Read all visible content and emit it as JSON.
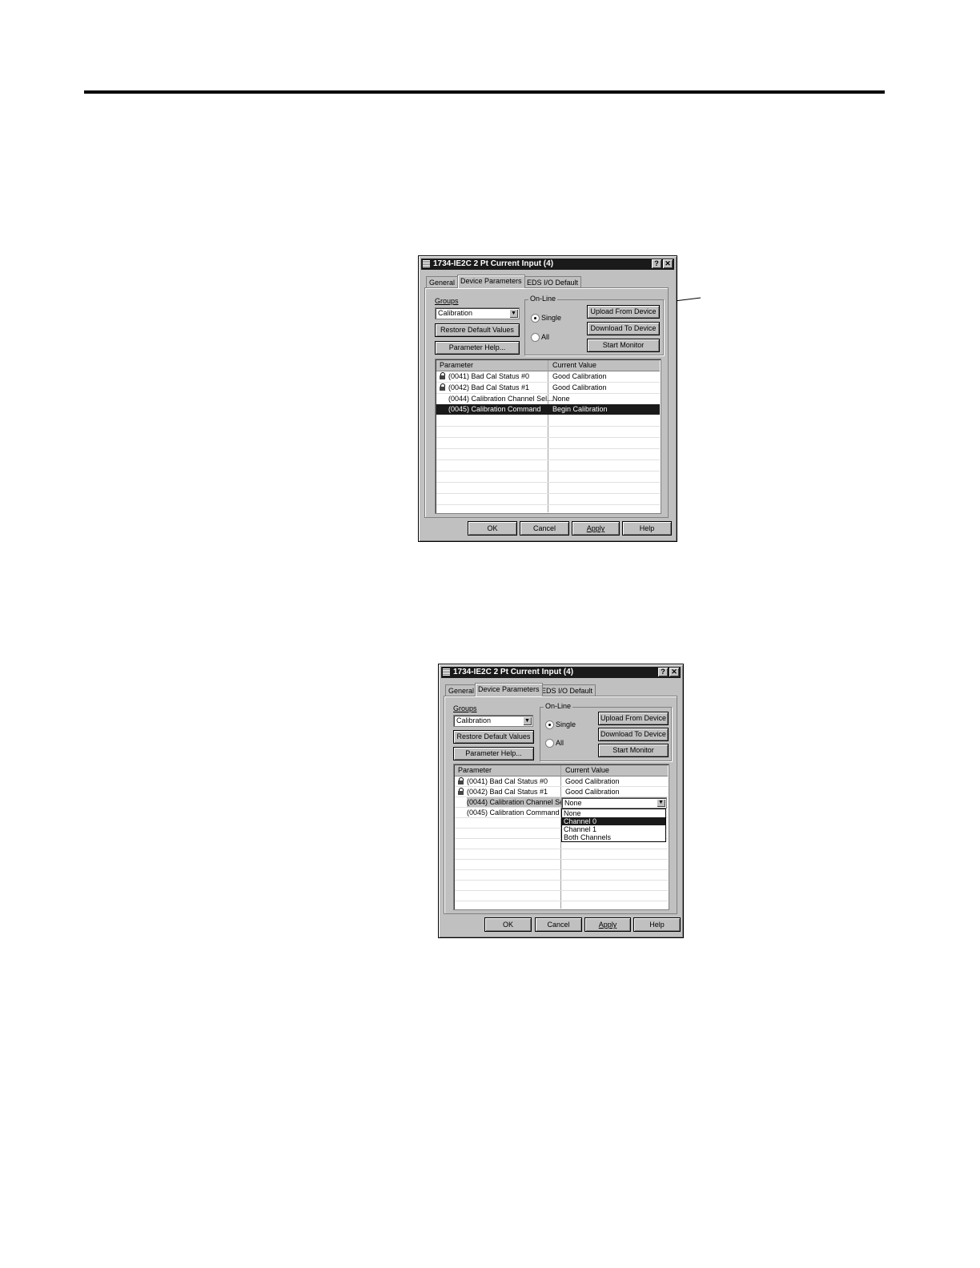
{
  "dialog1": {
    "title": "1734-IE2C 2 Pt Current Input (4)",
    "help_btn": "?",
    "close_btn": "✕",
    "tabs": [
      "General",
      "Device Parameters",
      "EDS I/O Default"
    ],
    "groups_label": "Groups",
    "groups_value": "Calibration",
    "restore_btn": "Restore Default Values",
    "param_help_btn": "Parameter Help...",
    "online_label": "On-Line",
    "radio_single": "Single",
    "radio_all": "All",
    "upload_btn": "Upload From Device",
    "download_btn": "Download To Device",
    "monitor_btn": "Start Monitor",
    "col_param": "Parameter",
    "col_value": "Current Value",
    "rows": [
      {
        "name": "(0041) Bad Cal Status #0",
        "value": "Good Calibration"
      },
      {
        "name": "(0042) Bad Cal Status #1",
        "value": "Good Calibration"
      },
      {
        "name": "(0044) Calibration Channel Sel...",
        "value": "None"
      },
      {
        "name": "(0045) Calibration Command",
        "value": "Begin Calibration"
      }
    ],
    "ok_btn": "OK",
    "cancel_btn": "Cancel",
    "apply_btn": "Apply",
    "helpbtn": "Help"
  },
  "dialog2": {
    "title": "1734-IE2C 2 Pt Current Input (4)",
    "help_btn": "?",
    "close_btn": "✕",
    "tabs": [
      "General",
      "Device Parameters",
      "EDS I/O Default"
    ],
    "groups_label": "Groups",
    "groups_value": "Calibration",
    "restore_btn": "Restore Default Values",
    "param_help_btn": "Parameter Help...",
    "online_label": "On-Line",
    "radio_single": "Single",
    "radio_all": "All",
    "upload_btn": "Upload From Device",
    "download_btn": "Download To Device",
    "monitor_btn": "Start Monitor",
    "col_param": "Parameter",
    "col_value": "Current Value",
    "rows": [
      {
        "name": "(0041) Bad Cal Status #0",
        "value": "Good Calibration"
      },
      {
        "name": "(0042) Bad Cal Status #1",
        "value": "Good Calibration"
      },
      {
        "name": "(0044) Calibration Channel Sel...",
        "value": "None"
      },
      {
        "name": "(0045) Calibration Command",
        "value": ""
      }
    ],
    "dropdown_options": [
      "None",
      "Channel 0",
      "Channel 1",
      "Both Channels"
    ],
    "ok_btn": "OK",
    "cancel_btn": "Cancel",
    "apply_btn": "Apply",
    "helpbtn": "Help"
  }
}
